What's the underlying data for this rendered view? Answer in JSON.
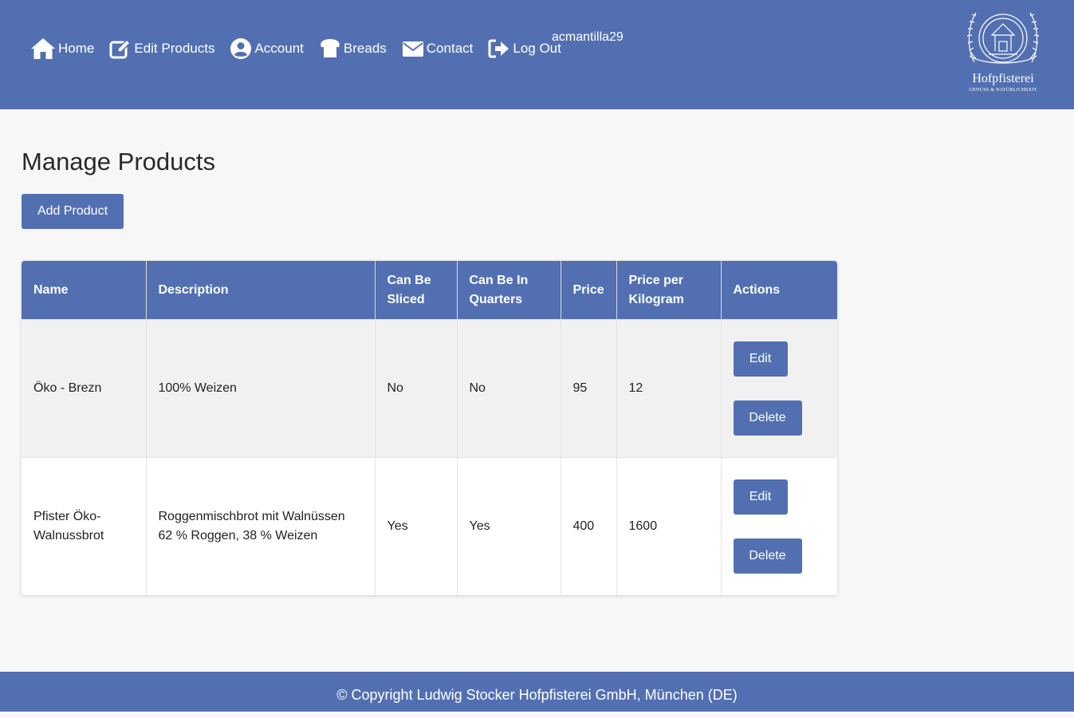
{
  "nav": {
    "items": [
      {
        "label": "Home",
        "icon": "home-icon"
      },
      {
        "label": "Edit Products",
        "icon": "edit-icon"
      },
      {
        "label": "Account",
        "icon": "user-circle-icon"
      },
      {
        "label": "Breads",
        "icon": "bread-icon"
      },
      {
        "label": "Contact",
        "icon": "envelope-icon"
      },
      {
        "label": "Log Out",
        "icon": "sign-out-icon"
      }
    ],
    "username": "acmantilla29"
  },
  "logo": {
    "name": "Hofpfisterei",
    "tagline": "GENUSS & NATÜRLICHKEIT"
  },
  "page": {
    "title": "Manage Products",
    "add_button": "Add Product"
  },
  "table": {
    "headers": [
      "Name",
      "Description",
      "Can Be Sliced",
      "Can Be In Quarters",
      "Price",
      "Price per Kilogram",
      "Actions"
    ],
    "rows": [
      {
        "name": "Öko - Brezn",
        "description": "100% Weizen",
        "sliced": "No",
        "quarters": "No",
        "price": "95",
        "price_per_kg": "12",
        "edit": "Edit",
        "delete": "Delete"
      },
      {
        "name": "Pfister Öko-Walnussbrot",
        "description": "Roggenmischbrot mit Walnüssen 62 % Roggen, 38 % Weizen",
        "sliced": "Yes",
        "quarters": "Yes",
        "price": "400",
        "price_per_kg": "1600",
        "edit": "Edit",
        "delete": "Delete"
      }
    ]
  },
  "footer": {
    "text": "© Copyright Ludwig Stocker Hofpfisterei GmbH, München (DE)"
  },
  "colors": {
    "brand": "#5270b1",
    "background": "#f7f7f7",
    "row_shade": "#f1f1f1"
  }
}
